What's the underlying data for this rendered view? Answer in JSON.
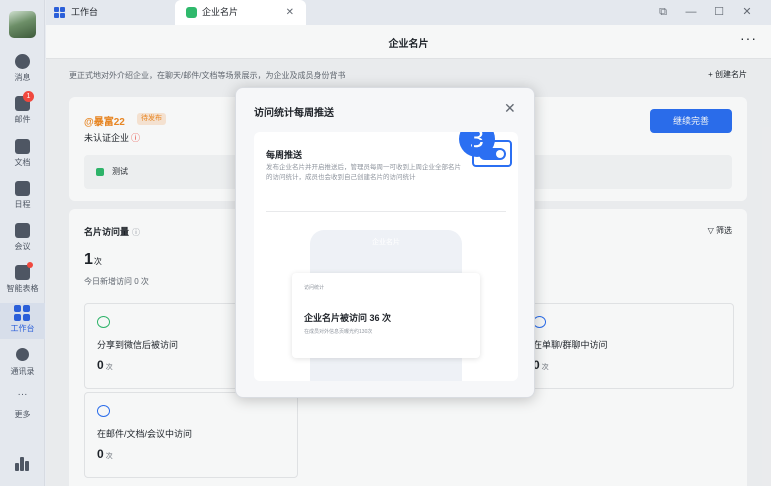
{
  "sidebar": {
    "items": [
      {
        "label": "消息"
      },
      {
        "label": "邮件",
        "badge": "1"
      },
      {
        "label": "文档"
      },
      {
        "label": "日程"
      },
      {
        "label": "会议"
      },
      {
        "label": "智能表格"
      },
      {
        "label": "工作台",
        "active": true
      },
      {
        "label": "通讯录"
      },
      {
        "label": "更多"
      }
    ]
  },
  "tabs": [
    {
      "label": "工作台"
    },
    {
      "label": "企业名片",
      "active": true
    }
  ],
  "page": {
    "title": "企业名片",
    "description": "更正式地对外介绍企业，在聊天/邮件/文档等场景展示，为企业及成员身份背书",
    "create_label": "+ 创建名片"
  },
  "profile": {
    "handle": "@暴富22",
    "tag": "待发布",
    "unverified": "未认证企业",
    "continue_label": "继续完善",
    "test_item": "测试"
  },
  "stats": {
    "title": "名片访问量",
    "filter_label": "筛选",
    "total_value": "1",
    "total_unit": "次",
    "today": "今日新增访问 0 次",
    "boxes": [
      {
        "label": "分享到微信后被访问",
        "value": "0",
        "unit": "次"
      },
      {
        "label": "在单聊/群聊中访问",
        "value": "0",
        "unit": "次"
      },
      {
        "label": "在邮件/文档/会议中访问",
        "value": "0",
        "unit": "次"
      }
    ]
  },
  "modal": {
    "title": "访问统计每周推送",
    "step": "3",
    "push_title": "每周推送",
    "push_desc": "发布企业名片并开启推送后，管理员每周一可收到上周企业全部名片的访问统计，成员也会收到自己创建名片的访问统计",
    "toggle_on": true,
    "preview": {
      "phone_label": "企业名片",
      "notice_head": "访问统计",
      "notice_title": "企业名片被访问 36 次",
      "notice_sub": "在成员对外信息页曝光约130次"
    }
  },
  "colors": {
    "accent": "#2b6ff2",
    "warning": "#f08a24",
    "badge": "#f0483e",
    "wechat_green": "#2fb96c"
  }
}
